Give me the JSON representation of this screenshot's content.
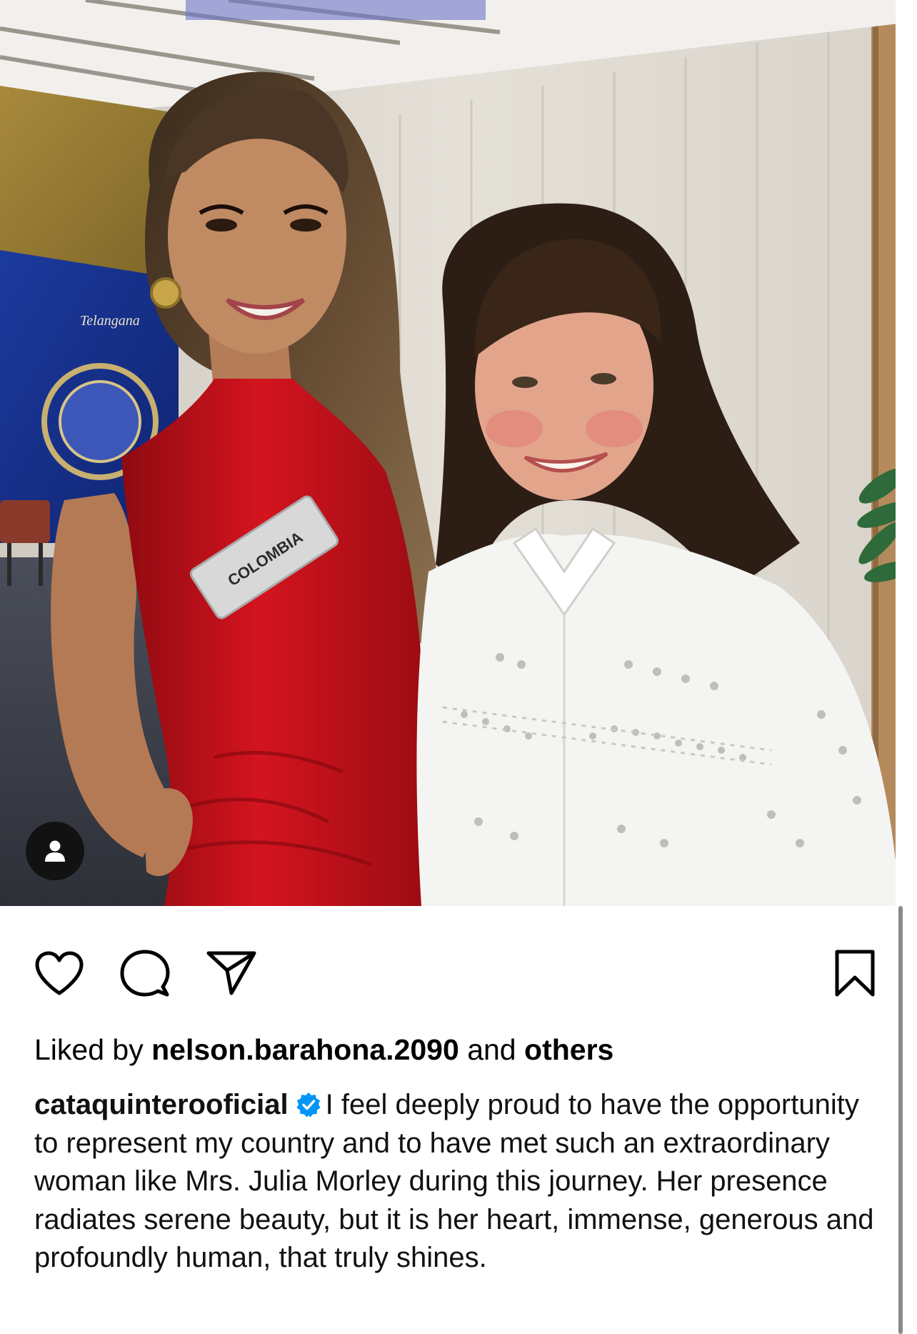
{
  "post": {
    "photo": {
      "badge_text": "COLOMBIA",
      "backdrop_text": "Telangana"
    },
    "user_tag_icon": "person-icon"
  },
  "actions": {
    "like_icon": "heart-outline-icon",
    "comment_icon": "comment-bubble-icon",
    "share_icon": "paper-plane-icon",
    "save_icon": "bookmark-outline-icon"
  },
  "likes": {
    "prefix": "Liked by",
    "user": "nelson.barahona.2090",
    "conjunction": "and",
    "others": "others"
  },
  "caption": {
    "username": "cataquinterooficial",
    "verified_icon": "verified-badge-icon",
    "text": "I feel deeply proud to have the opportunity to represent my country and to have met such an extraordinary woman like Mrs. Julia Morley during this journey. Her presence radiates serene beauty, but it is her heart, immense, generous and profoundly human, that truly shines."
  },
  "colors": {
    "text": "#000000",
    "verified": "#0095f6",
    "dress": "#c4101a",
    "background": "#ffffff"
  }
}
